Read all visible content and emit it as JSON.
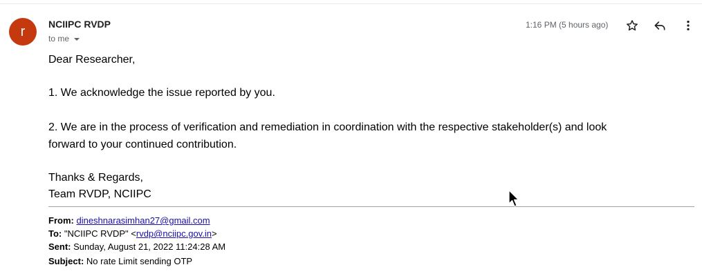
{
  "header": {
    "avatar_letter": "r",
    "sender_name": "NCIIPC RVDP",
    "recipient": "to me",
    "time": "1:16 PM (5 hours ago)",
    "icons": [
      "star-icon",
      "reply-icon",
      "more-vert-icon"
    ],
    "avatar_color": "#c5390f"
  },
  "body": {
    "greeting": "Dear Researcher,",
    "line1": "1. We acknowledge the issue reported by you.",
    "line2a": "2. We are in the process of verification and remediation in coordination with the respective stakeholder(s) and look",
    "line2b": "forward to your continued contribution.",
    "signoff1": "Thanks & Regards,",
    "signoff2": "Team RVDP, NCIIPC"
  },
  "quoted": {
    "from_label": "From:",
    "from_email": "dineshnarasimhan27@gmail.com",
    "to_label": "To:",
    "to_name": "\"NCIIPC RVDP\" <",
    "to_email": "rvdp@nciipc.gov.in",
    "to_close": ">",
    "sent_label": "Sent:",
    "sent_value": "Sunday, August 21, 2022 11:24:28 AM",
    "subject_label": "Subject:",
    "subject_value": "No rate Limit sending OTP"
  }
}
